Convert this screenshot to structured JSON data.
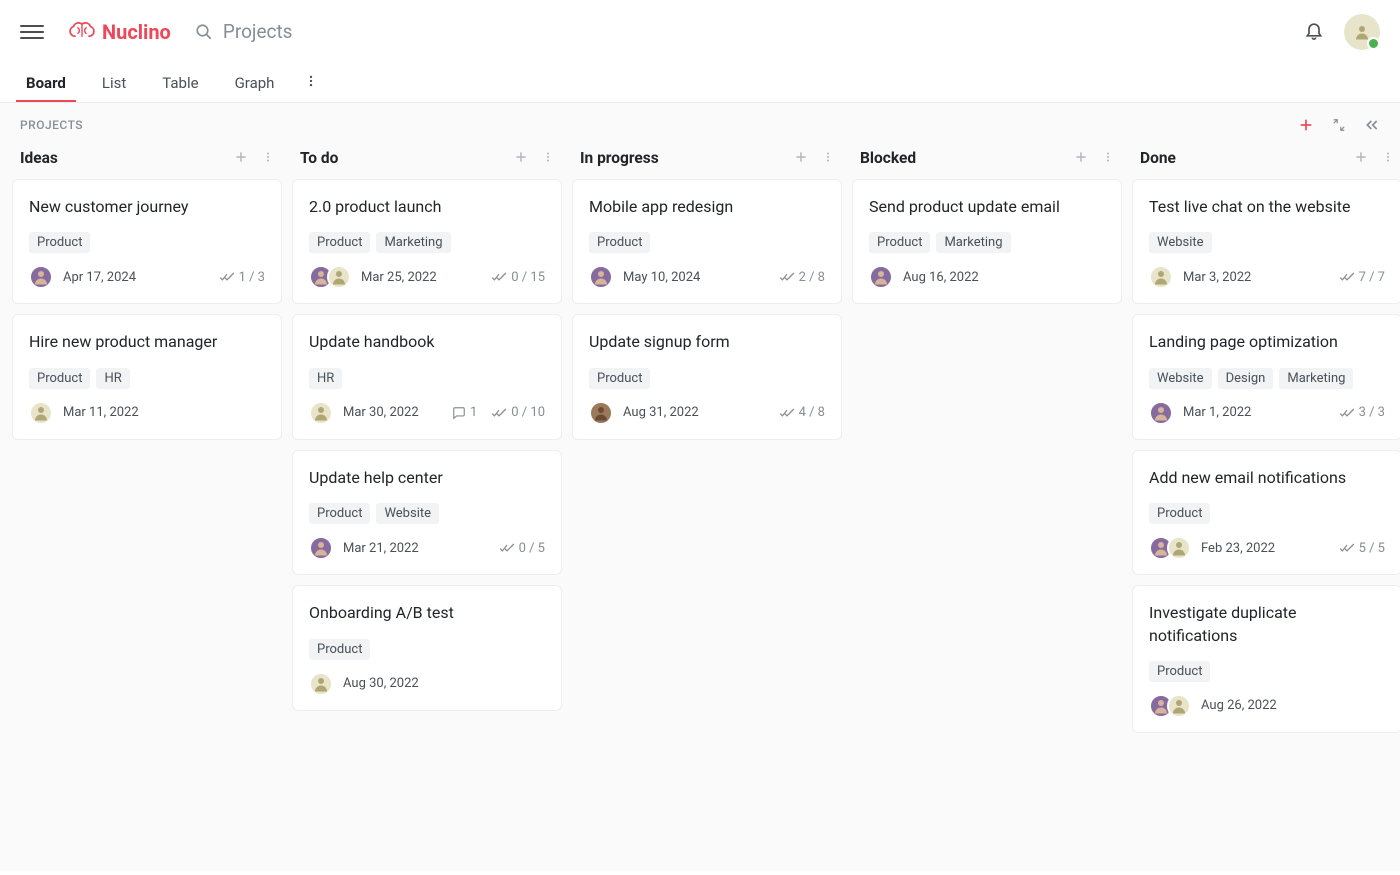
{
  "app_name": "Nuclino",
  "search_placeholder": "Projects",
  "tabs": {
    "board": "Board",
    "list": "List",
    "table": "Table",
    "graph": "Graph"
  },
  "subheader": "PROJECTS",
  "colors": {
    "avatar_purple": "#866b9e",
    "avatar_tan": "#e8e4c9",
    "avatar_brown": "#9b7a5a"
  },
  "columns": [
    {
      "title": "Ideas",
      "cards": [
        {
          "title": "New customer journey",
          "tags": [
            "Product"
          ],
          "assignees": [
            "purple"
          ],
          "date": "Apr 17, 2024",
          "checks": "1 / 3"
        },
        {
          "title": "Hire new product manager",
          "tags": [
            "Product",
            "HR"
          ],
          "assignees": [
            "tan"
          ],
          "date": "Mar 11, 2022"
        }
      ]
    },
    {
      "title": "To do",
      "cards": [
        {
          "title": "2.0 product launch",
          "tags": [
            "Product",
            "Marketing"
          ],
          "assignees": [
            "purple",
            "tan"
          ],
          "date": "Mar 25, 2022",
          "checks": "0 / 15"
        },
        {
          "title": "Update handbook",
          "tags": [
            "HR"
          ],
          "assignees": [
            "tan"
          ],
          "date": "Mar 30, 2022",
          "comments": "1",
          "checks": "0 / 10"
        },
        {
          "title": "Update help center",
          "tags": [
            "Product",
            "Website"
          ],
          "assignees": [
            "purple"
          ],
          "date": "Mar 21, 2022",
          "checks": "0 / 5"
        },
        {
          "title": "Onboarding A/B test",
          "tags": [
            "Product"
          ],
          "assignees": [
            "tan"
          ],
          "date": "Aug 30, 2022"
        }
      ]
    },
    {
      "title": "In progress",
      "cards": [
        {
          "title": "Mobile app redesign",
          "tags": [
            "Product"
          ],
          "assignees": [
            "purple"
          ],
          "date": "May 10, 2024",
          "checks": "2 / 8"
        },
        {
          "title": "Update signup form",
          "tags": [
            "Product"
          ],
          "assignees": [
            "brown"
          ],
          "date": "Aug 31, 2022",
          "checks": "4 / 8"
        }
      ]
    },
    {
      "title": "Blocked",
      "cards": [
        {
          "title": "Send product update email",
          "tags": [
            "Product",
            "Marketing"
          ],
          "assignees": [
            "purple"
          ],
          "date": "Aug 16, 2022"
        }
      ]
    },
    {
      "title": "Done",
      "cards": [
        {
          "title": "Test live chat on the website",
          "tags": [
            "Website"
          ],
          "assignees": [
            "tan"
          ],
          "date": "Mar 3, 2022",
          "checks": "7 / 7"
        },
        {
          "title": "Landing page optimization",
          "tags": [
            "Website",
            "Design",
            "Marketing"
          ],
          "assignees": [
            "purple"
          ],
          "date": "Mar 1, 2022",
          "checks": "3 / 3"
        },
        {
          "title": "Add new email notifications",
          "tags": [
            "Product"
          ],
          "assignees": [
            "purple",
            "tan"
          ],
          "date": "Feb 23, 2022",
          "checks": "5 / 5"
        },
        {
          "title": "Investigate duplicate notifications",
          "tags": [
            "Product"
          ],
          "assignees": [
            "purple",
            "tan"
          ],
          "date": "Aug 26, 2022"
        }
      ]
    }
  ]
}
